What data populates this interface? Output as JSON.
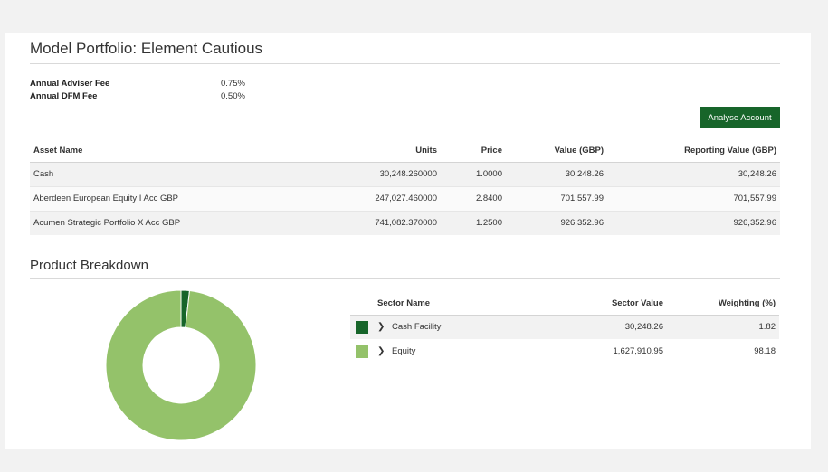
{
  "page": {
    "title": "Model Portfolio: Element Cautious",
    "fees": [
      {
        "label": "Annual Adviser Fee",
        "value": "0.75%"
      },
      {
        "label": "Annual DFM Fee",
        "value": "0.50%"
      }
    ],
    "analyse_button": "Analyse Account"
  },
  "holdings": {
    "headers": {
      "asset_name": "Asset Name",
      "units": "Units",
      "price": "Price",
      "value": "Value (GBP)",
      "reporting_value": "Reporting Value (GBP)"
    },
    "rows": [
      {
        "asset": "Cash",
        "units": "30,248.260000",
        "price": "1.0000",
        "value": "30,248.26",
        "reporting": "30,248.26"
      },
      {
        "asset": "Aberdeen European Equity I Acc GBP",
        "units": "247,027.460000",
        "price": "2.8400",
        "value": "701,557.99",
        "reporting": "701,557.99"
      },
      {
        "asset": "Acumen Strategic Portfolio X Acc GBP",
        "units": "741,082.370000",
        "price": "1.2500",
        "value": "926,352.96",
        "reporting": "926,352.96"
      }
    ]
  },
  "breakdown": {
    "title": "Product Breakdown",
    "headers": {
      "sector_name": "Sector Name",
      "sector_value": "Sector Value",
      "weighting": "Weighting (%)"
    },
    "sectors": [
      {
        "name": "Cash Facility",
        "value": "30,248.26",
        "weighting": "1.82",
        "color": "#17652a",
        "icon": "chevron-right-icon"
      },
      {
        "name": "Equity",
        "value": "1,627,910.95",
        "weighting": "98.18",
        "color": "#94c26a",
        "icon": "chevron-right-icon"
      }
    ]
  },
  "chart_data": {
    "type": "pie",
    "labels": [
      "Cash Facility",
      "Equity"
    ],
    "values": [
      1.82,
      98.18
    ],
    "colors": [
      "#17652a",
      "#94c26a"
    ]
  }
}
